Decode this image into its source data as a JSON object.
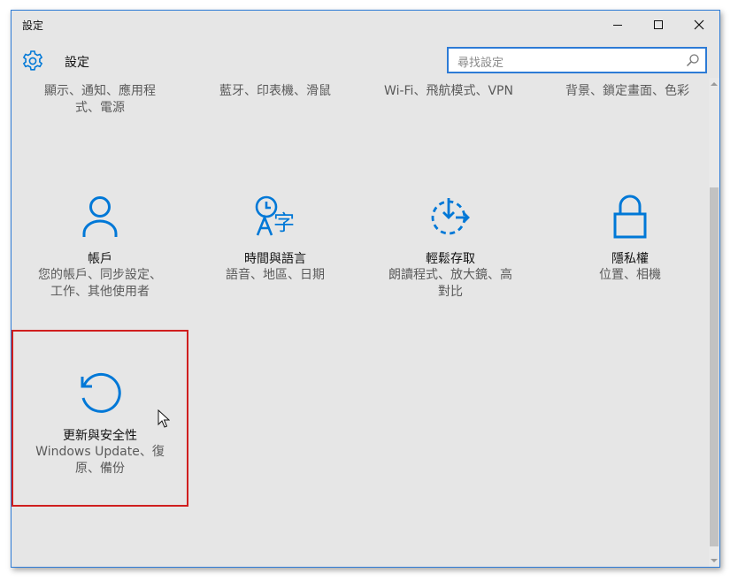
{
  "window": {
    "title": "設定"
  },
  "header": {
    "title": "設定",
    "icon": "gear-icon"
  },
  "search": {
    "placeholder": "尋找設定",
    "icon": "search-icon"
  },
  "top_row": [
    {
      "line1": "顯示、通知、應用程",
      "line2": "式、電源"
    },
    {
      "line1": "藍牙、印表機、滑鼠",
      "line2": ""
    },
    {
      "line1": "Wi-Fi、飛航模式、VPN",
      "line2": ""
    },
    {
      "line1": "背景、鎖定畫面、色彩",
      "line2": ""
    }
  ],
  "tiles": [
    {
      "title": "帳戶",
      "desc1": "您的帳戶、同步設定、",
      "desc2": "工作、其他使用者",
      "icon": "person-icon"
    },
    {
      "title": "時間與語言",
      "desc1": "語音、地區、日期",
      "desc2": "",
      "icon": "time-language-icon"
    },
    {
      "title": "輕鬆存取",
      "desc1": "朗讀程式、放大鏡、高",
      "desc2": "對比",
      "icon": "ease-of-access-icon"
    },
    {
      "title": "隱私權",
      "desc1": "位置、相機",
      "desc2": "",
      "icon": "lock-icon"
    },
    {
      "title": "更新與安全性",
      "desc1": "Windows Update、復",
      "desc2": "原、備份",
      "icon": "update-icon"
    }
  ],
  "colors": {
    "accent": "#0078d7",
    "highlight": "#d01f1f"
  }
}
